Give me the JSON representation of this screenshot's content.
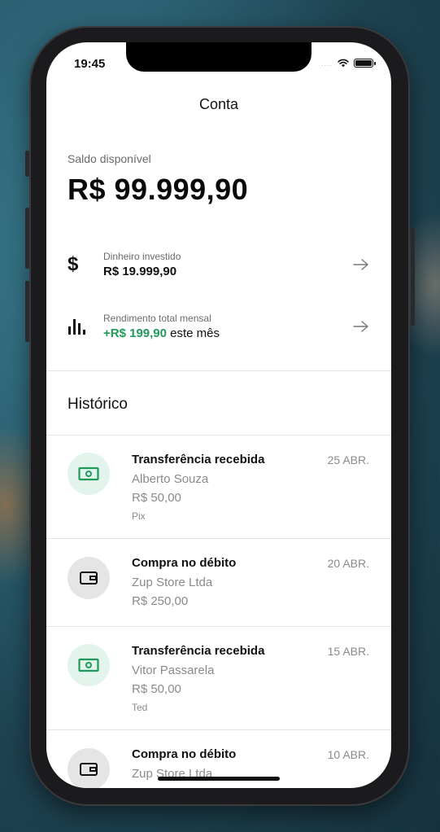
{
  "status_bar": {
    "time": "19:45",
    "signal": "....",
    "icons": [
      "wifi-icon",
      "battery-icon"
    ]
  },
  "header": {
    "title": "Conta"
  },
  "balance": {
    "label": "Saldo disponível",
    "value": "R$ 99.999,90"
  },
  "summary": [
    {
      "icon": "dollar-icon",
      "label": "Dinheiro investido",
      "value": "R$ 19.999,90",
      "suffix": ""
    },
    {
      "icon": "bar-chart-icon",
      "label": "Rendimento total mensal",
      "value": "+R$ 199,90",
      "suffix": " este mês"
    }
  ],
  "history": {
    "title": "Histórico",
    "transactions": [
      {
        "icon": "banknote-icon",
        "type": "Transferência recebida",
        "date": "25 ABR.",
        "name": "Alberto Souza",
        "amount": "R$ 50,00",
        "method": "Pix"
      },
      {
        "icon": "wallet-icon",
        "type": "Compra no débito",
        "date": "20 ABR.",
        "name": "Zup Store Ltda",
        "amount": "R$ 250,00",
        "method": ""
      },
      {
        "icon": "banknote-icon",
        "type": "Transferência recebida",
        "date": "15 ABR.",
        "name": "Vitor Passarela",
        "amount": "R$ 50,00",
        "method": "Ted"
      },
      {
        "icon": "wallet-icon",
        "type": "Compra no débito",
        "date": "10 ABR.",
        "name": "Zup Store Ltda",
        "amount": "",
        "method": ""
      }
    ]
  },
  "colors": {
    "accent_green": "#1f9a5b",
    "green_circle": "#e3f4ec",
    "gray_circle": "#e5e5e5"
  }
}
